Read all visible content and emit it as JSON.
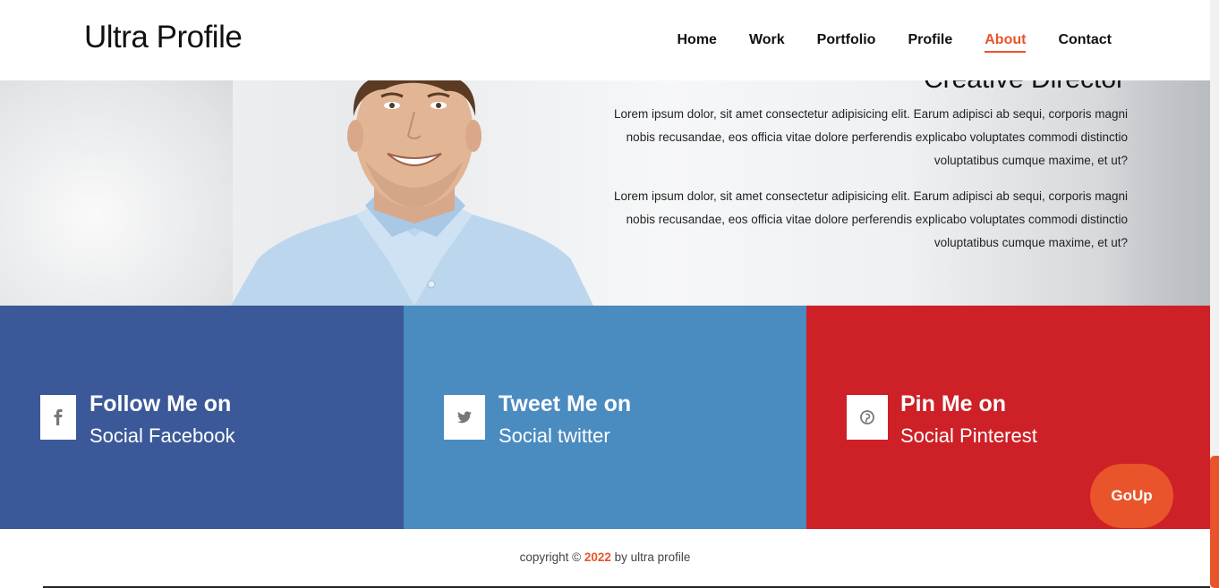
{
  "header": {
    "logo": "Ultra Profile",
    "nav": [
      {
        "label": "Home",
        "active": false
      },
      {
        "label": "Work",
        "active": false
      },
      {
        "label": "Portfolio",
        "active": false
      },
      {
        "label": "Profile",
        "active": false
      },
      {
        "label": "About",
        "active": true
      },
      {
        "label": "Contact",
        "active": false
      }
    ]
  },
  "hero": {
    "heading": "Creative Director",
    "paragraph1": "Lorem ipsum dolor, sit amet consectetur adipisicing elit. Earum adipisci ab sequi, corporis magni nobis recusandae, eos officia vitae dolore perferendis explicabo voluptates commodi distinctio voluptatibus cumque maxime, et ut?",
    "paragraph2": "Lorem ipsum dolor, sit amet consectetur adipisicing elit. Earum adipisci ab sequi, corporis magni nobis recusandae, eos officia vitae dolore perferendis explicabo voluptates commodi distinctio voluptatibus cumque maxime, et ut?"
  },
  "social": [
    {
      "title": "Follow Me on",
      "subtitle": "Social Facebook",
      "icon": "facebook-icon",
      "color": "#3b5998"
    },
    {
      "title": "Tweet Me on",
      "subtitle": "Social twitter",
      "icon": "twitter-icon",
      "color": "#4a8bc0"
    },
    {
      "title": "Pin Me on",
      "subtitle": "Social Pinterest",
      "icon": "pinterest-icon",
      "color": "#cd2027"
    }
  ],
  "goup": {
    "label": "GoUp"
  },
  "footer": {
    "prefix": "copyright ©",
    "year": "2022",
    "suffix": "by ultra profile"
  },
  "colors": {
    "accent": "#e9542a",
    "facebook": "#3b5998",
    "twitter": "#4a8bc0",
    "pinterest": "#cd2027"
  }
}
